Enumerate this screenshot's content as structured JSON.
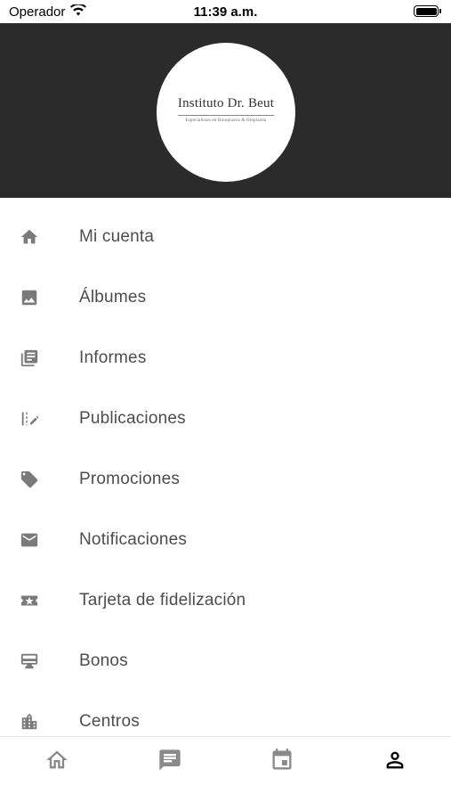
{
  "status_bar": {
    "carrier": "Operador",
    "time": "11:39 a.m."
  },
  "header": {
    "logo_title": "Instituto Dr. Beut",
    "logo_subtitle": "Especialistas en Rinoplastia & Otoplastia"
  },
  "menu": {
    "items": [
      {
        "label": "Mi cuenta",
        "icon": "home-icon"
      },
      {
        "label": "Álbumes",
        "icon": "image-icon"
      },
      {
        "label": "Informes",
        "icon": "library-books-icon"
      },
      {
        "label": "Publicaciones",
        "icon": "edit-note-icon"
      },
      {
        "label": "Promociones",
        "icon": "tag-icon"
      },
      {
        "label": "Notificaciones",
        "icon": "mail-icon"
      },
      {
        "label": "Tarjeta de fidelización",
        "icon": "loyalty-card-icon"
      },
      {
        "label": "Bonos",
        "icon": "voucher-icon"
      },
      {
        "label": "Centros",
        "icon": "building-icon"
      }
    ]
  },
  "tab_bar": {
    "tabs": [
      {
        "icon": "home-outline-icon",
        "active": false
      },
      {
        "icon": "chat-icon",
        "active": false
      },
      {
        "icon": "calendar-icon",
        "active": false
      },
      {
        "icon": "person-icon",
        "active": true
      }
    ]
  },
  "colors": {
    "header_background": "#2b2b2b",
    "icon_gray": "#7a7a7a",
    "text_gray": "#4d4d4d",
    "active_tab": "#000000"
  }
}
